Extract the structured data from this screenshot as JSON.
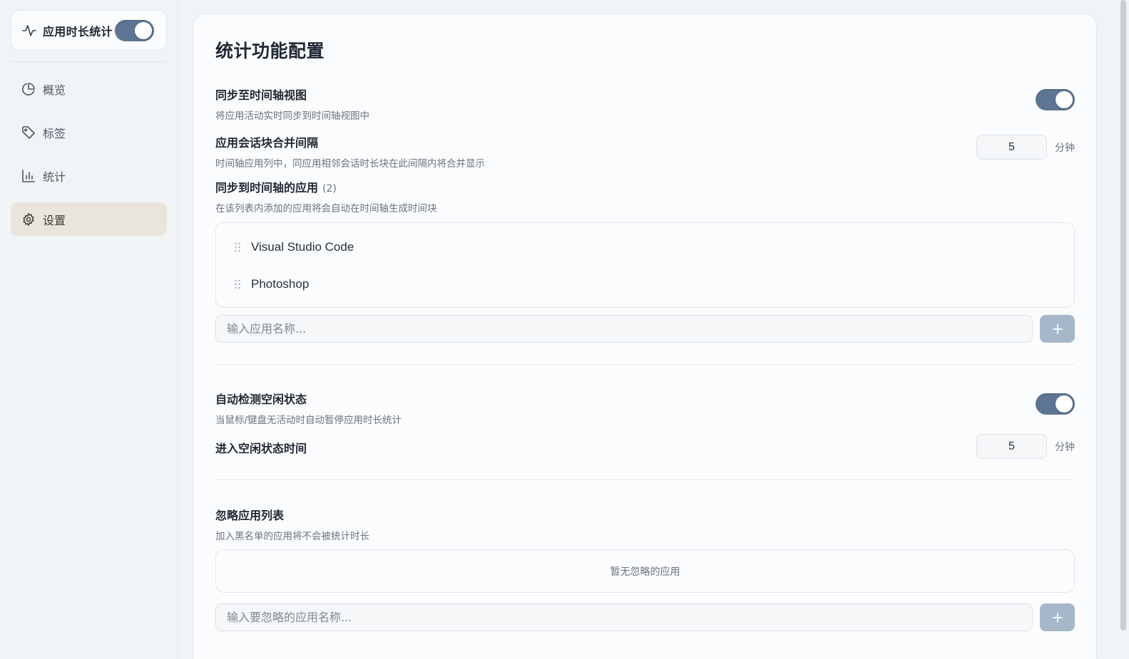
{
  "sidebar": {
    "brand_title": "应用时长统计",
    "brand_toggle_on": true,
    "items": [
      {
        "label": "概览",
        "icon": "pie-chart-icon",
        "active": false
      },
      {
        "label": "标签",
        "icon": "tag-icon",
        "active": false
      },
      {
        "label": "统计",
        "icon": "bar-chart-icon",
        "active": false
      },
      {
        "label": "设置",
        "icon": "gear-icon",
        "active": true
      }
    ]
  },
  "main": {
    "title": "统计功能配置",
    "sync_timeline": {
      "title": "同步至时间轴视图",
      "desc": "将应用活动实时同步到时间轴视图中",
      "enabled": true
    },
    "merge_interval": {
      "title": "应用会话块合并间隔",
      "desc": "时间轴应用列中，同应用相邻会话时长块在此间隔内将合并显示",
      "value": "5",
      "unit": "分钟"
    },
    "synced_apps": {
      "title": "同步到时间轴的应用",
      "count": "(2)",
      "desc": "在该列表内添加的应用将会自动在时间轴生成时间块",
      "apps": [
        "Visual Studio Code",
        "Photoshop"
      ],
      "input_placeholder": "输入应用名称...",
      "add_label": "+"
    },
    "idle_detect": {
      "title": "自动检测空闲状态",
      "desc": "当鼠标/键盘无活动时自动暂停应用时长统计",
      "enabled": true
    },
    "idle_time": {
      "title": "进入空闲状态时间",
      "value": "5",
      "unit": "分钟"
    },
    "ignored_apps": {
      "title": "忽略应用列表",
      "desc": "加入黑名单的应用将不会被统计时长",
      "empty_text": "暂无忽略的应用",
      "input_placeholder": "输入要忽略的应用名称...",
      "add_label": "+"
    }
  },
  "colors": {
    "accent": "#5d7593",
    "active_nav_bg": "#e9e5db",
    "add_button": "#a6b7ca",
    "page_bg": "#f1f4f7",
    "card_bg": "#fbfcfd"
  }
}
